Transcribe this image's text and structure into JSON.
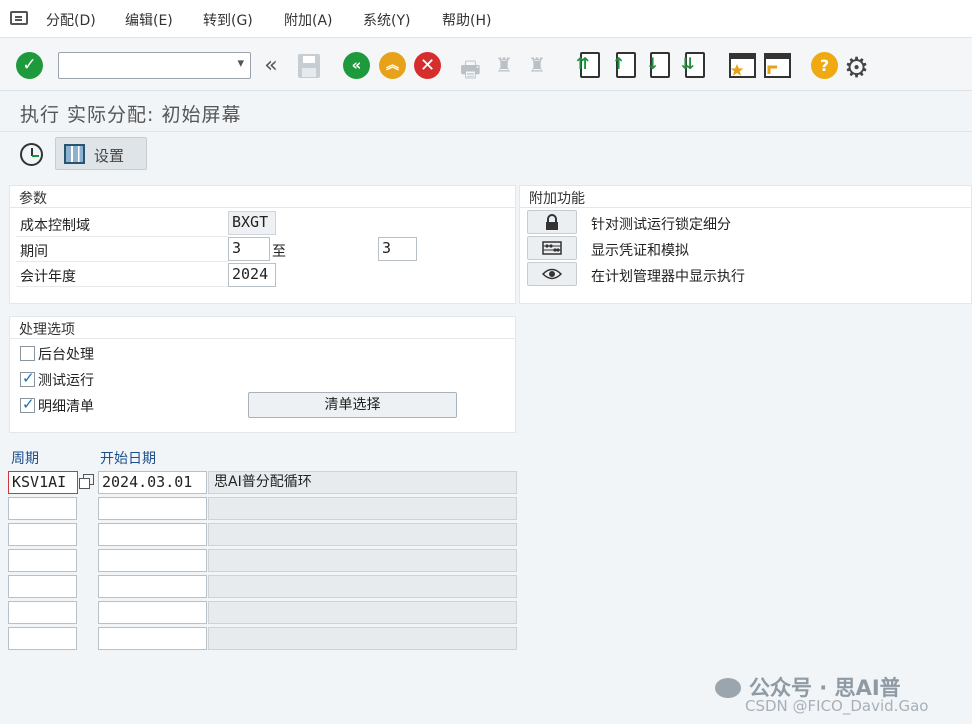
{
  "menu": [
    "分配(D)",
    "编辑(E)",
    "转到(G)",
    "附加(A)",
    "系统(Y)",
    "帮助(H)"
  ],
  "toolbar": {
    "command_value": ""
  },
  "title": "执行 实际分配: 初始屏幕",
  "app_toolbar": {
    "settings_label": "设置"
  },
  "params": {
    "title": "参数",
    "controlling_area": {
      "label": "成本控制域",
      "value": "BXGT"
    },
    "period": {
      "label": "期间",
      "from": "3",
      "to_label": "至",
      "to": "3"
    },
    "fiscal_year": {
      "label": "会计年度",
      "value": "2024"
    }
  },
  "extras": {
    "title": "附加功能",
    "items": [
      "针对测试运行锁定细分",
      "显示凭证和模拟",
      "在计划管理器中显示执行"
    ]
  },
  "options": {
    "title": "处理选项",
    "background": {
      "label": "后台处理",
      "checked": false
    },
    "test_run": {
      "label": "测试运行",
      "checked": true
    },
    "detail_list": {
      "label": "明细清单",
      "checked": true
    },
    "list_select_label": "清单选择"
  },
  "cycles": {
    "headers": [
      "周期",
      "开始日期"
    ],
    "rows": [
      {
        "cycle": "KSV1AI",
        "start": "2024.03.01",
        "desc": "思AI普分配循环"
      },
      {
        "cycle": "",
        "start": "",
        "desc": ""
      },
      {
        "cycle": "",
        "start": "",
        "desc": ""
      },
      {
        "cycle": "",
        "start": "",
        "desc": ""
      },
      {
        "cycle": "",
        "start": "",
        "desc": ""
      },
      {
        "cycle": "",
        "start": "",
        "desc": ""
      },
      {
        "cycle": "",
        "start": "",
        "desc": ""
      }
    ]
  },
  "watermark": {
    "text": "公众号 · 思AI普",
    "csdn": "CSDN @FICO_David.Gao"
  }
}
